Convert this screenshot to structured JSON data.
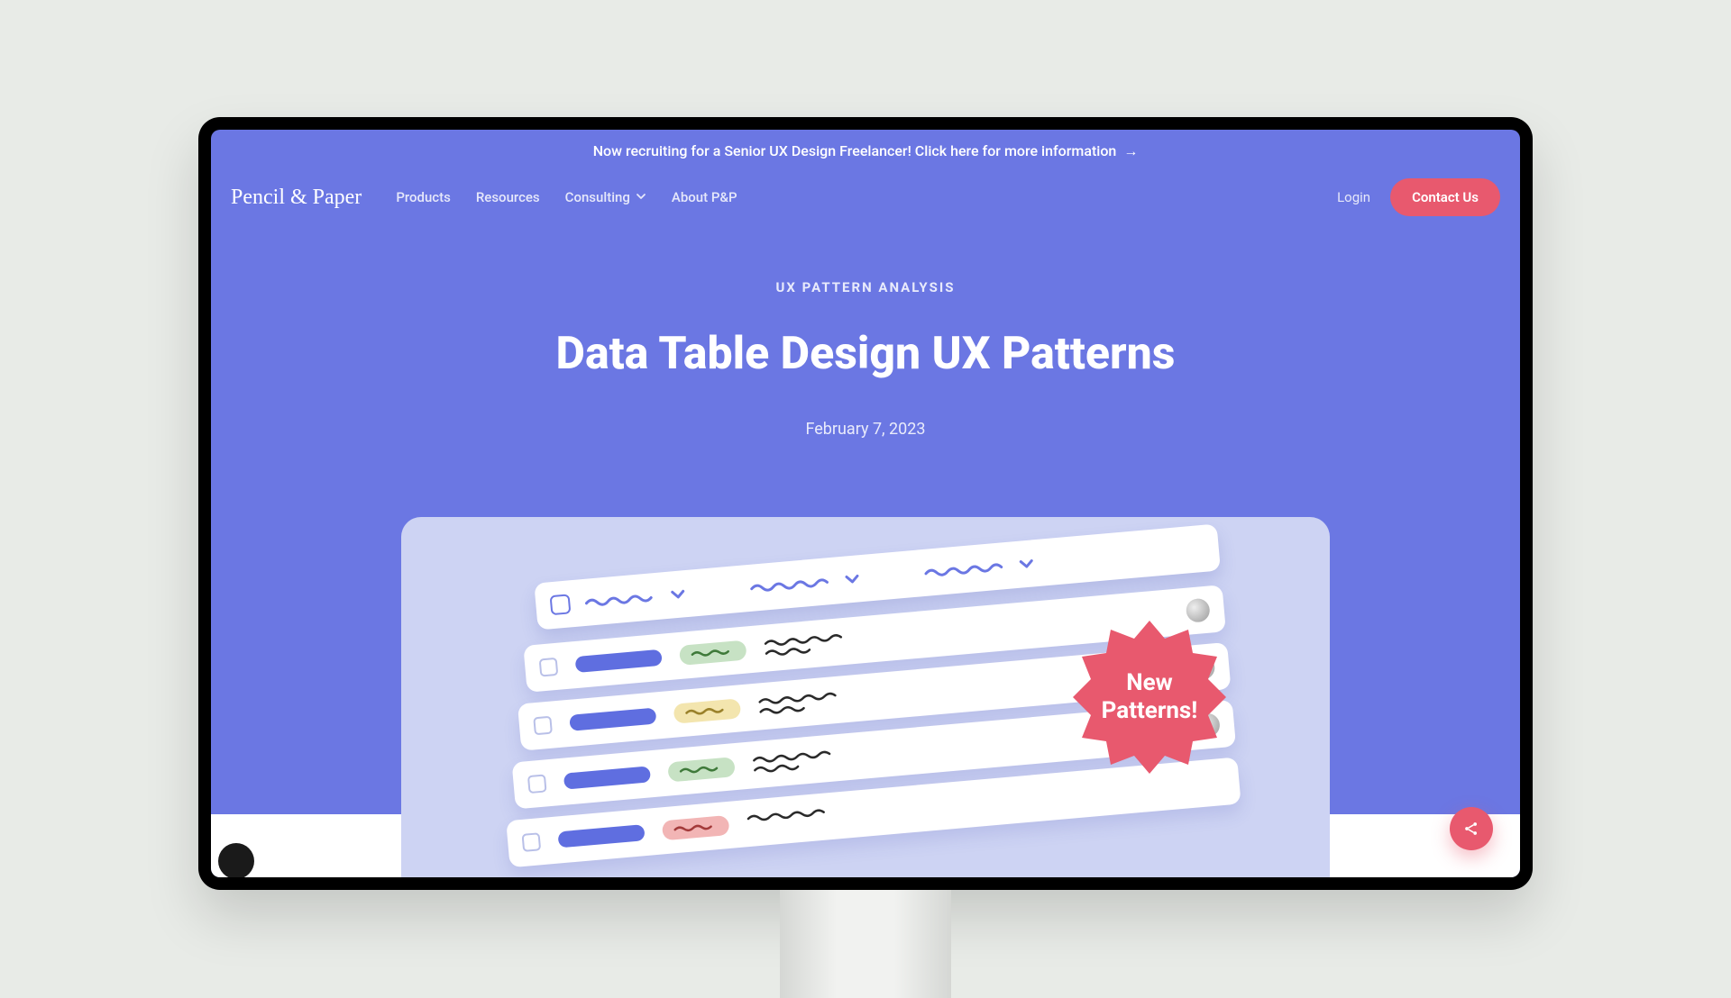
{
  "announcement": {
    "text": "Now recruiting for a Senior UX Design Freelancer! Click here for more information",
    "arrow": "→"
  },
  "brand": "Pencil & Paper",
  "nav": {
    "products": "Products",
    "resources": "Resources",
    "consulting": "Consulting",
    "about": "About P&P"
  },
  "auth": {
    "login": "Login",
    "contact": "Contact Us"
  },
  "hero": {
    "eyebrow": "UX PATTERN ANALYSIS",
    "title": "Data Table Design UX Patterns",
    "date": "February 7, 2023"
  },
  "badge": {
    "line1": "New",
    "line2": "Patterns!"
  },
  "colors": {
    "primary": "#6b77e3",
    "accent": "#e8596e"
  }
}
